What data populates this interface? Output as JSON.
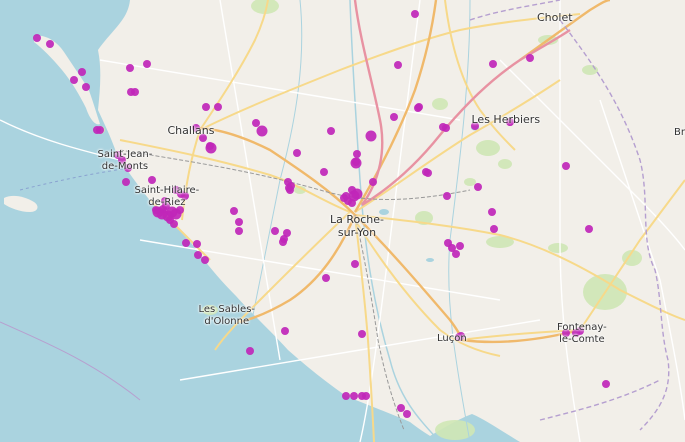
{
  "map": {
    "marker_color": "#c026b9",
    "water_color": "#aad3df",
    "land_color": "#f2efe9",
    "places": [
      {
        "key": "cholet",
        "lines": [
          "Cholet"
        ]
      },
      {
        "key": "les-herbiers",
        "lines": [
          "Les Herbiers"
        ]
      },
      {
        "key": "challans",
        "lines": [
          "Challans"
        ]
      },
      {
        "key": "saint-jean-de-monts",
        "lines": [
          "Saint-Jean-",
          "de-Monts"
        ]
      },
      {
        "key": "saint-hilaire-de-riez",
        "lines": [
          "Saint-Hilaire-",
          "de-Riez"
        ]
      },
      {
        "key": "la-roche-sur-yon",
        "lines": [
          "La Roche-",
          "sur-Yon"
        ]
      },
      {
        "key": "les-sables-d-olonne",
        "lines": [
          "Les Sables-",
          "d'Olonne"
        ]
      },
      {
        "key": "lucon",
        "lines": [
          "Luçon"
        ]
      },
      {
        "key": "fontenay-le-comte",
        "lines": [
          "Fontenay-",
          "le-Comte"
        ]
      },
      {
        "key": "br",
        "lines": [
          "Br"
        ]
      }
    ]
  }
}
